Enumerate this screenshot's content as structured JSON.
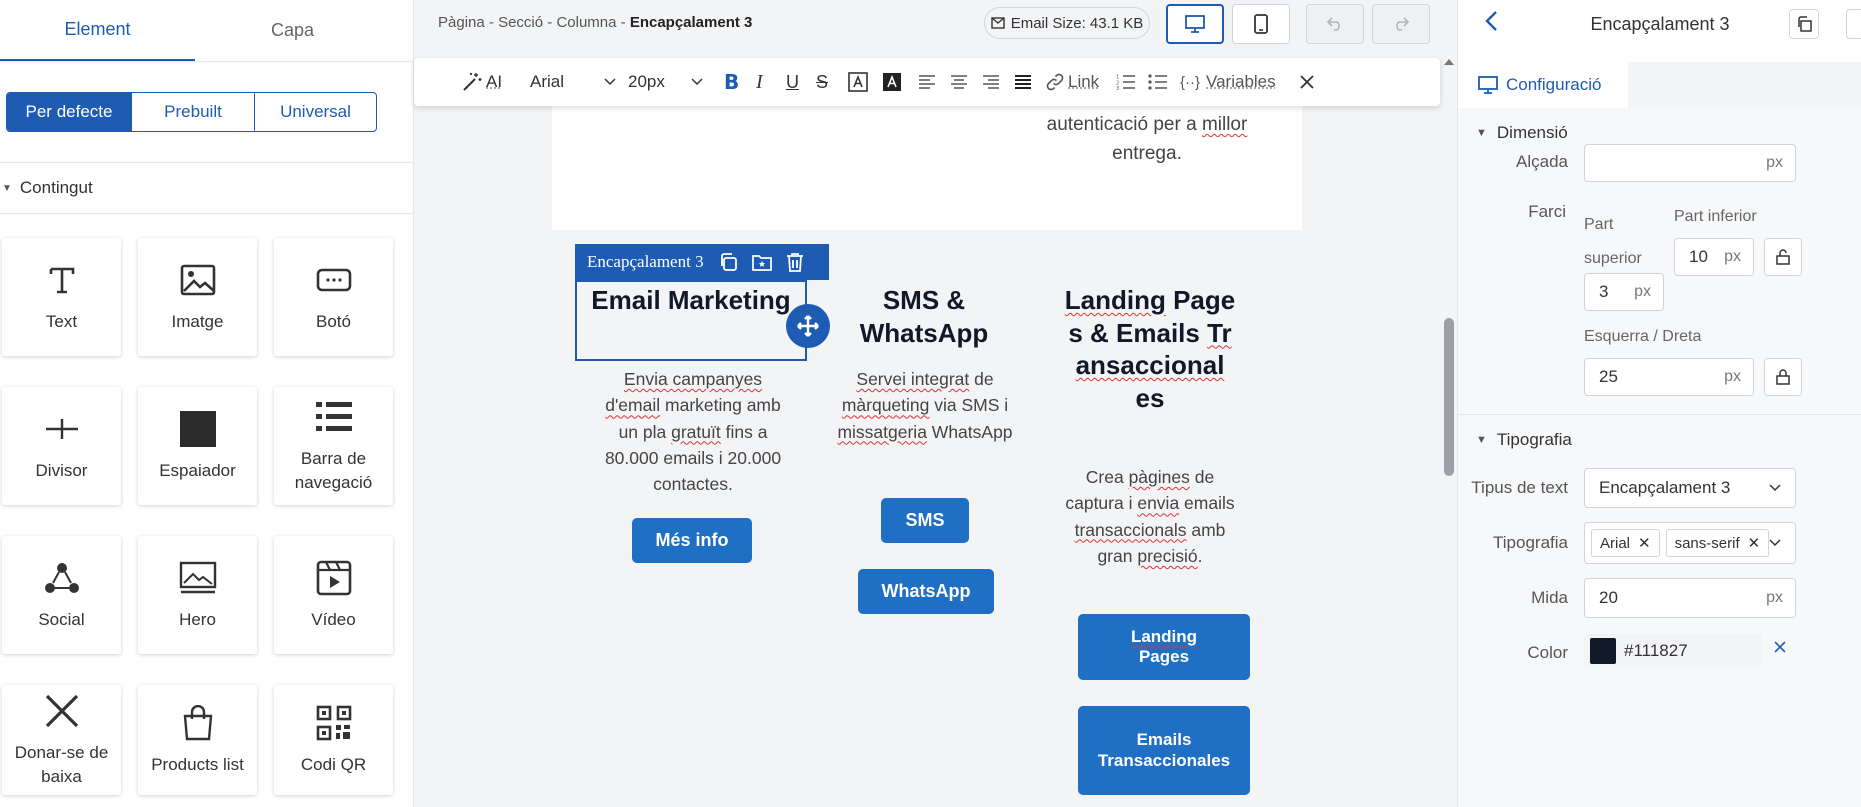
{
  "left": {
    "tabs": [
      "Element",
      "Capa"
    ],
    "segments": [
      "Per defecte",
      "Prebuilt",
      "Universal"
    ],
    "section_title": "Contingut",
    "tiles": [
      {
        "label": "Text",
        "icon": "text-icon"
      },
      {
        "label": "Imatge",
        "icon": "image-icon"
      },
      {
        "label": "Botó",
        "icon": "button-icon"
      },
      {
        "label": "Divisor",
        "icon": "divider-icon"
      },
      {
        "label": "Espaiador",
        "icon": "spacer-icon"
      },
      {
        "label": "Barra de navegació",
        "icon": "navbar-icon"
      },
      {
        "label": "Social",
        "icon": "social-icon"
      },
      {
        "label": "Hero",
        "icon": "hero-icon"
      },
      {
        "label": "Vídeo",
        "icon": "video-icon"
      },
      {
        "label": "Donar-se de baixa",
        "icon": "unsubscribe-icon"
      },
      {
        "label": "Products list",
        "icon": "shopping-bag-icon"
      },
      {
        "label": "Codi QR",
        "icon": "qr-code-icon"
      }
    ]
  },
  "topbar": {
    "breadcrumb": [
      "Pàgina",
      "Secció",
      "Columna"
    ],
    "breadcrumb_current": "Encapçalament 3",
    "email_size": "Email Size: 43.1 KB"
  },
  "format_toolbar": {
    "ai": "AI",
    "font": "Arial",
    "size": "20px",
    "link": "Link",
    "variables": "Variables"
  },
  "canvas": {
    "prev_text": [
      "autenticació per a ",
      "millor",
      " entrega."
    ],
    "selection_tag": "Encapçalament 3",
    "columns": [
      {
        "heading": "Email Marketing",
        "text": "Envia campanyes d'email marketing amb un pla gratuït fins a 80.000 emails i 20.000 contactes.",
        "buttons": [
          "Més info"
        ]
      },
      {
        "heading": "SMS & WhatsApp",
        "text": "Servei integrat de màrqueting via SMS i missatgeria WhatsApp",
        "buttons": [
          "SMS",
          "WhatsApp"
        ]
      },
      {
        "heading": "Landing Pages & Emails Transaccionales",
        "text": "Crea pàgines de captura i envia emails transaccionals amb gran precisió.",
        "buttons": [
          "Landing Pages",
          "Emails Transaccionales"
        ]
      }
    ]
  },
  "right": {
    "title": "Encapçalament 3",
    "tab": "Configuració",
    "dimension": {
      "title": "Dimensió",
      "height_label": "Alçada",
      "height_value": "",
      "unit": "px",
      "padding_label": "Farci",
      "top_label": "Part superior",
      "top_value": "3",
      "bottom_label": "Part inferior",
      "bottom_value": "10",
      "lr_label": "Esquerra / Dreta",
      "lr_value": "25"
    },
    "typography": {
      "title": "Tipografia",
      "text_type_label": "Tipus de text",
      "text_type_value": "Encapçalament 3",
      "font_label": "Tipografia",
      "font_chips": [
        "Arial",
        "sans-serif"
      ],
      "size_label": "Mida",
      "size_value": "20",
      "color_label": "Color",
      "color_value": "#111827"
    }
  },
  "colors": {
    "accent": "#1e5bb3",
    "button": "#1f6fc4",
    "heading": "#111827"
  }
}
